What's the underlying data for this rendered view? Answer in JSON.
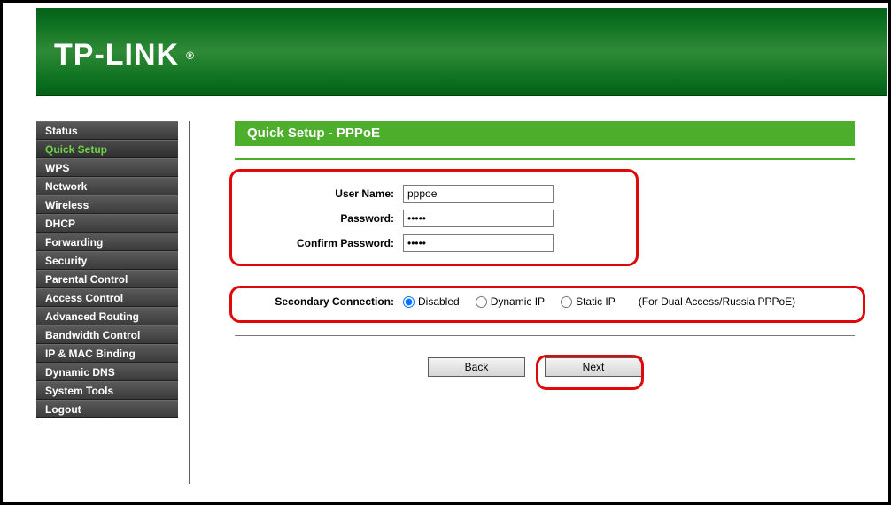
{
  "brand": "TP-LINK",
  "page_title": "Quick Setup - PPPoE",
  "sidebar": {
    "items": [
      {
        "label": "Status",
        "active": false
      },
      {
        "label": "Quick Setup",
        "active": true
      },
      {
        "label": "WPS",
        "active": false
      },
      {
        "label": "Network",
        "active": false
      },
      {
        "label": "Wireless",
        "active": false
      },
      {
        "label": "DHCP",
        "active": false
      },
      {
        "label": "Forwarding",
        "active": false
      },
      {
        "label": "Security",
        "active": false
      },
      {
        "label": "Parental Control",
        "active": false
      },
      {
        "label": "Access Control",
        "active": false
      },
      {
        "label": "Advanced Routing",
        "active": false
      },
      {
        "label": "Bandwidth Control",
        "active": false
      },
      {
        "label": "IP & MAC Binding",
        "active": false
      },
      {
        "label": "Dynamic DNS",
        "active": false
      },
      {
        "label": "System Tools",
        "active": false
      },
      {
        "label": "Logout",
        "active": false
      }
    ]
  },
  "form": {
    "username_label": "User Name:",
    "username_value": "pppoe",
    "password_label": "Password:",
    "password_value": "•••••",
    "confirm_label": "Confirm Password:",
    "confirm_value": "•••••",
    "secondary_label": "Secondary Connection:",
    "options": {
      "disabled": "Disabled",
      "dynamic": "Dynamic IP",
      "static": "Static IP"
    },
    "selected": "disabled",
    "note": "(For Dual Access/Russia PPPoE)"
  },
  "buttons": {
    "back": "Back",
    "next": "Next"
  }
}
